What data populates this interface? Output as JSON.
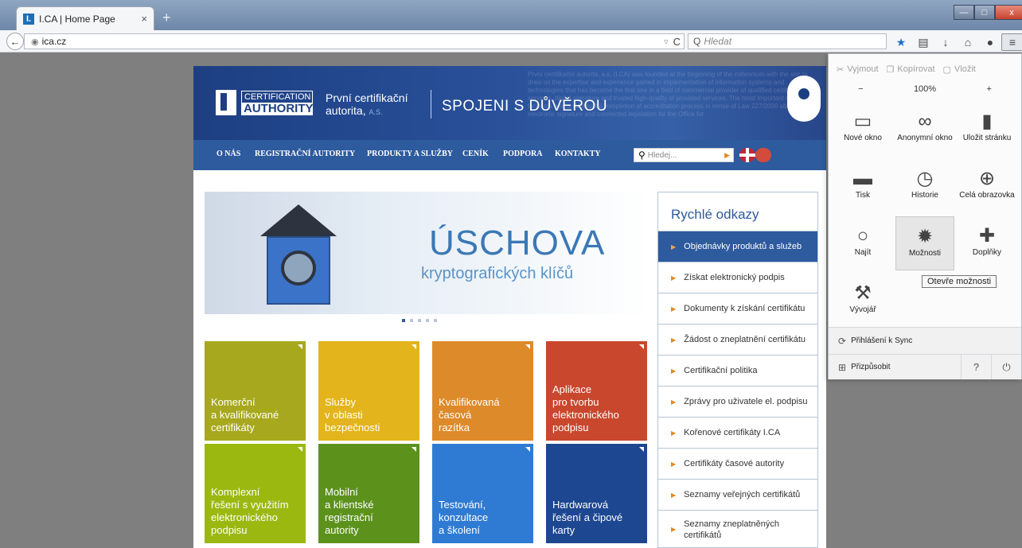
{
  "browser": {
    "tab_title": "I.CA | Home Page",
    "tab_favicon": "I.",
    "tab_close": "×",
    "new_tab": "+",
    "window_controls": {
      "minimize": "—",
      "maximize": "□",
      "close": "x"
    },
    "back": "←",
    "url": "ica.cz",
    "reload": "C",
    "url_arrows": "▿",
    "search_placeholder": "Hledat",
    "toolbar_icons": [
      "star-icon",
      "reading-list-icon",
      "download-icon",
      "home-icon",
      "chat-icon",
      "menu-icon"
    ]
  },
  "site": {
    "logo": {
      "line1": "CERTIFICATION",
      "line2": "AUTHORITY"
    },
    "brand_line1": "První certifikační",
    "brand_line2": "autorita,",
    "brand_suffix": "A.S.",
    "slogan": "SPOJENI S DŮVĚROU",
    "header_blurb": "První certifikační autorita, a.s. (I.CA) was founded at the beginning of the millennium with the aim to draw on the expertise and experience gained in implementation of information systems and technologies that has become the first one in a field of commercial provider of qualified certification services, digital signature and trusted high-quality of provided services. The most important step forwards was a successful completion of accreditation process in sense of Law 227/2000 about electronic signature and connected legislation for the Office for",
    "menu": [
      "O NÁS",
      "REGISTRAČNÍ AUTORITY",
      "PRODUKTY A SLUŽBY",
      "CENÍK",
      "PODPORA",
      "KONTAKTY"
    ],
    "search_placeholder": "Hledej...",
    "search_arrow": "▶",
    "hero": {
      "title": "ÚSCHOVA",
      "subtitle": "kryptografických klíčů"
    },
    "tiles": [
      {
        "text": "Komerční\na kvalifikované\ncertifikáty",
        "color": "#a7a81e"
      },
      {
        "text": "Služby\nv oblasti\nbezpečnosti",
        "color": "#e3b41b"
      },
      {
        "text": "Kvalifikovaná\nčasová\nrazítka",
        "color": "#dd8a2a"
      },
      {
        "text": "Aplikace\npro tvorbu\nelektronického\npodpisu",
        "color": "#c9472d"
      },
      {
        "text": "Komplexní\nřešení s využitím\nelektronického\npodpisu",
        "color": "#9bb811"
      },
      {
        "text": "Mobilní\na klientské\nregistrační\nautority",
        "color": "#5c921c"
      },
      {
        "text": "Testování,\nkonzultace\na školení",
        "color": "#2f7bd3"
      },
      {
        "text": "Hardwarová\nřešení a čipové\nkarty",
        "color": "#1d4790"
      }
    ],
    "quick_links": {
      "title": "Rychlé odkazy",
      "bullet": "▶",
      "items": [
        "Objednávky produktů a služeb",
        "Získat elektronický podpis",
        "Dokumenty k získání certifikátu",
        "Žádost o zneplatnění certifikátu",
        "Certifikační politika",
        "Zprávy pro uživatele el. podpisu",
        "Kořenové certifikáty I.CA",
        "Certifikáty časové autority",
        "Seznamy veřejných certifikátů",
        "Seznamy zneplatněných certifikátů"
      ]
    }
  },
  "panel": {
    "edit": {
      "cut": "Vyjmout",
      "copy": "Kopírovat",
      "paste": "Vložit"
    },
    "zoom": {
      "minus": "−",
      "value": "100%",
      "plus": "+"
    },
    "buttons": [
      {
        "label": "Nové okno",
        "icon": "window-icon",
        "glyph": "▭"
      },
      {
        "label": "Anonymní okno",
        "icon": "mask-icon",
        "glyph": "∞"
      },
      {
        "label": "Uložit stránku",
        "icon": "page-icon",
        "glyph": "▮"
      },
      {
        "label": "Tisk",
        "icon": "printer-icon",
        "glyph": "▬"
      },
      {
        "label": "Historie",
        "icon": "clock-icon",
        "glyph": "◷"
      },
      {
        "label": "Celá obrazovka",
        "icon": "fullscreen-icon",
        "glyph": "⊕"
      },
      {
        "label": "Najít",
        "icon": "magnifier-icon",
        "glyph": "○"
      },
      {
        "label": "Možnosti",
        "icon": "gear-icon",
        "glyph": "✹"
      },
      {
        "label": "Doplňky",
        "icon": "puzzle-icon",
        "glyph": "✚"
      },
      {
        "label": "Vývojář",
        "icon": "wrench-icon",
        "glyph": "⚒"
      }
    ],
    "tooltip": "Otevře možnosti",
    "sync": "Přihlášení k Sync",
    "customize": "Přizpůsobit",
    "help": "?",
    "quit": "⏻"
  }
}
